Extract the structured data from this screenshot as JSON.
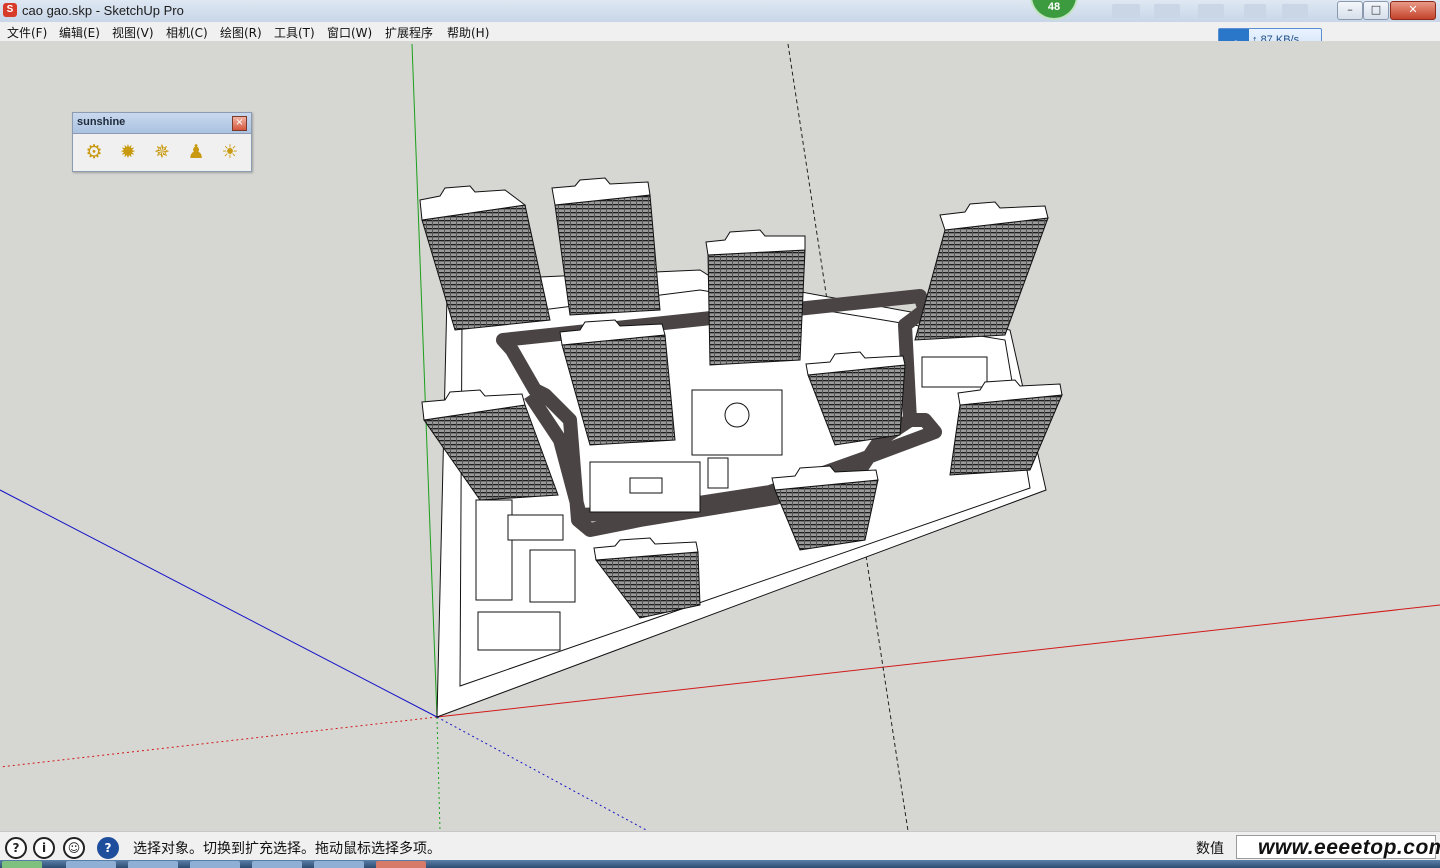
{
  "window": {
    "title": "cao gao.skp - SketchUp Pro",
    "app_icon": "sketchup-icon",
    "minimize_glyph": "–",
    "maximize_glyph": "□",
    "close_glyph": "✕"
  },
  "notification": {
    "count": "48"
  },
  "menu": {
    "items": [
      "文件(F)",
      "编辑(E)",
      "视图(V)",
      "相机(C)",
      "绘图(R)",
      "工具(T)",
      "窗口(W)",
      "扩展程序",
      "帮助(H)"
    ]
  },
  "network_widget": {
    "icon": "cloud-upload-icon",
    "speed": "87 KB/s",
    "arrow": "↑"
  },
  "sunshine_toolbar": {
    "title": "sunshine",
    "close_glyph": "×",
    "tools": [
      {
        "name": "sunshine-settings-icon",
        "glyph": "⚙"
      },
      {
        "name": "sun-analysis-icon",
        "glyph": "✹"
      },
      {
        "name": "sun-path-icon",
        "glyph": "✵"
      },
      {
        "name": "shadow-person-icon",
        "glyph": "♟"
      },
      {
        "name": "sun-export-icon",
        "glyph": "☀"
      }
    ]
  },
  "statusbar": {
    "hint": "选择对象。切换到扩充选择。拖动鼠标选择多项。",
    "measurement_label": "数值",
    "measurement_value": "",
    "icons": [
      {
        "name": "geo-location-icon",
        "glyph": "?"
      },
      {
        "name": "credits-info-icon",
        "glyph": "i"
      },
      {
        "name": "user-account-icon",
        "glyph": "☺"
      },
      {
        "name": "help-icon",
        "glyph": "?"
      }
    ]
  },
  "watermark": "www.eeeetop.com",
  "colors": {
    "axis_red": "#d11a1a",
    "axis_green": "#1aa01a",
    "axis_blue": "#1515c8",
    "road": "#4a4444",
    "ground": "#ffffff",
    "viewport_bg": "#d6d6d2"
  }
}
